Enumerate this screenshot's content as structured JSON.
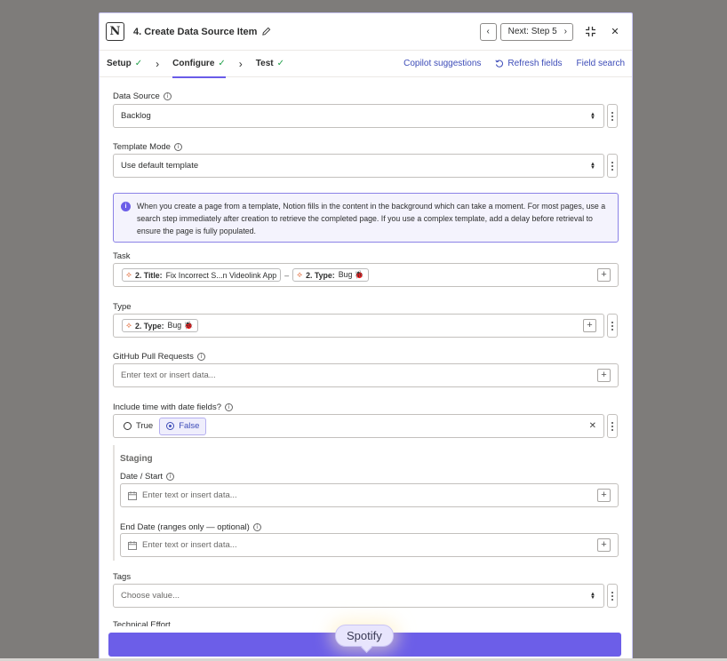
{
  "header": {
    "title": "4. Create Data Source Item",
    "next_label": "Next: Step 5"
  },
  "tabs": [
    {
      "label": "Setup"
    },
    {
      "label": "Configure"
    },
    {
      "label": "Test"
    }
  ],
  "tab_links": {
    "copilot": "Copilot suggestions",
    "refresh": "Refresh fields",
    "search": "Field search"
  },
  "fields": {
    "data_source": {
      "label": "Data Source",
      "value": "Backlog"
    },
    "template_mode": {
      "label": "Template Mode",
      "value": "Use default template"
    },
    "info_text": "When you create a page from a template, Notion fills in the content in the background which can take a moment. For most pages, use a search step immediately after creation to retrieve the completed page. If you use a complex template, add a delay before retrieval to ensure the page is fully populated.",
    "task": {
      "label": "Task",
      "pill1_key": "2. Title:",
      "pill1_val": "Fix Incorrect S...n Videolink App",
      "separator": "–",
      "pill2_key": "2. Type:",
      "pill2_val": "Bug 🐞"
    },
    "type": {
      "label": "Type",
      "pill_key": "2. Type:",
      "pill_val": "Bug 🐞"
    },
    "github": {
      "label": "GitHub Pull Requests",
      "placeholder": "Enter text or insert data..."
    },
    "include_time": {
      "label": "Include time with date fields?",
      "opt_true": "True",
      "opt_false": "False"
    },
    "staging": {
      "title": "Staging",
      "date_start": {
        "label": "Date / Start",
        "placeholder": "Enter text or insert data..."
      },
      "end_date": {
        "label": "End Date (ranges only — optional)",
        "placeholder": "Enter text or insert data..."
      }
    },
    "tags": {
      "label": "Tags",
      "placeholder": "Choose value..."
    },
    "technical_effort": {
      "label": "Technical Effort"
    }
  },
  "tooltip": "Spotify",
  "colors": {
    "accent": "#6c5ee8",
    "check": "#22a04b",
    "link": "#3d4cb8"
  }
}
